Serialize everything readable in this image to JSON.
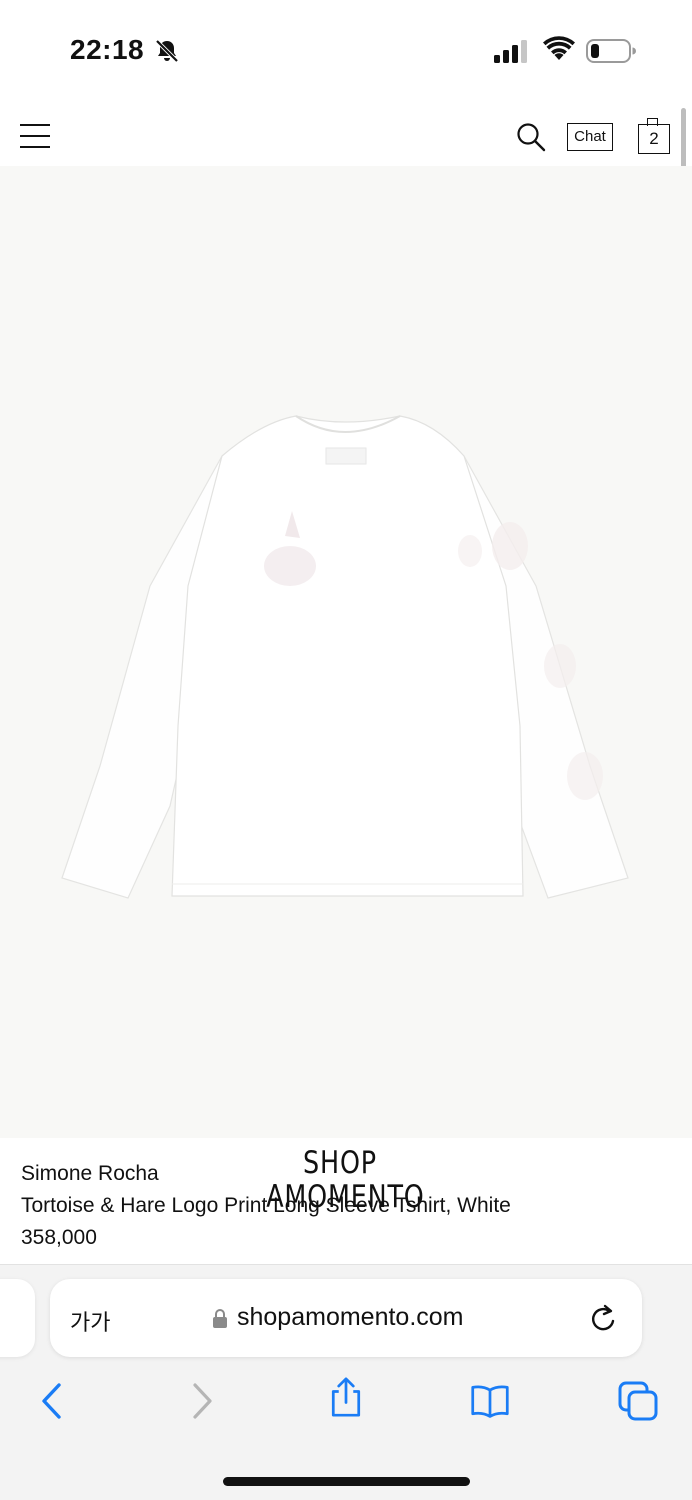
{
  "status_bar": {
    "time": "22:18",
    "icons": [
      "bell-slash-icon",
      "signal-icon",
      "wifi-icon",
      "battery-icon"
    ]
  },
  "header": {
    "chat_label": "Chat",
    "cart_count": "2",
    "icons": [
      "menu-icon",
      "search-icon",
      "cart-icon"
    ]
  },
  "product": {
    "image_alt_icon": "tshirt-back-image",
    "brand": "Simone Rocha",
    "title": "Tortoise & Hare Logo Print Long Sleeve Tshirt, White",
    "price": "358,000"
  },
  "logo": {
    "line1": "SHOP",
    "line2": "AMOMENTO"
  },
  "browser": {
    "text_size_label": "가가",
    "url": "shopamomento.com",
    "icons": [
      "lock-icon",
      "reload-icon",
      "back-icon",
      "forward-icon",
      "share-icon",
      "bookmarks-icon",
      "tabs-icon"
    ]
  },
  "colors": {
    "accent": "#1a7cf5",
    "disabled": "#b5b5b5",
    "image_bg": "#f8f8f6"
  }
}
